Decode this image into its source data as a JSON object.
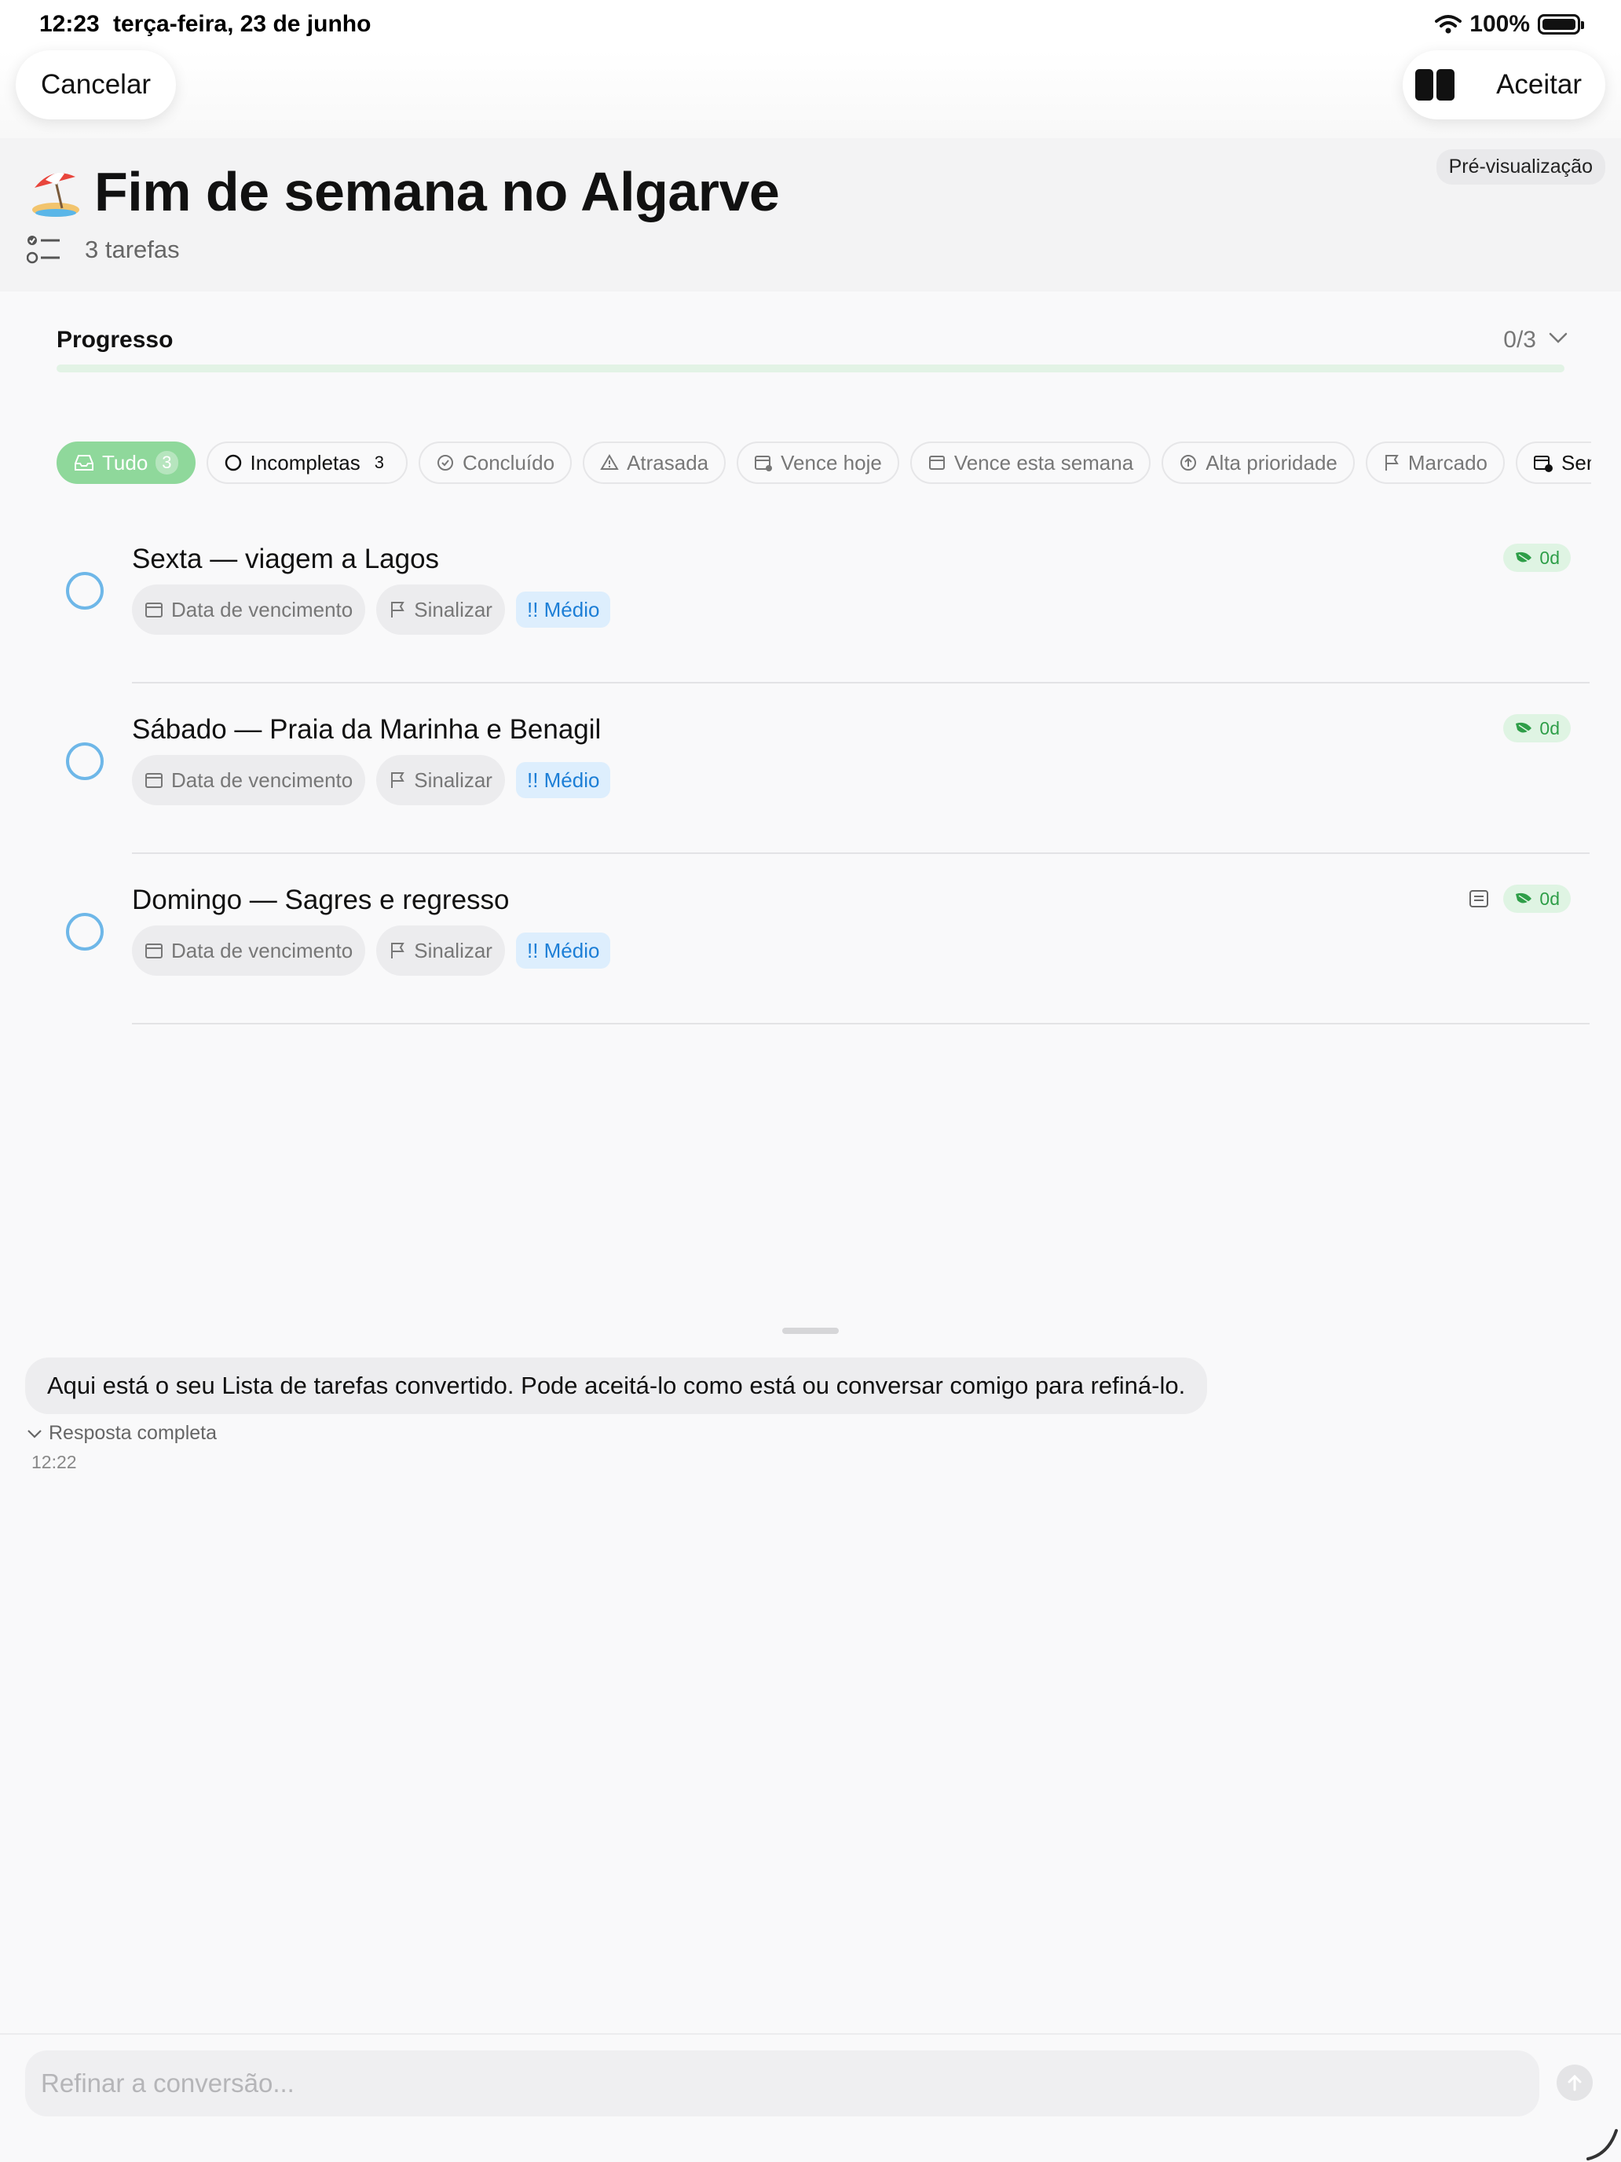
{
  "status_bar": {
    "time": "12:23",
    "date": "terça-feira, 23 de junho",
    "battery": "100%"
  },
  "nav": {
    "cancel_label": "Cancelar",
    "accept_label": "Aceitar"
  },
  "header": {
    "preview_badge": "Pré-visualização",
    "title": "Fim de semana no Algarve",
    "task_count": "3 tarefas"
  },
  "progress": {
    "label": "Progresso",
    "count": "0/3",
    "fraction": 0
  },
  "filters": [
    {
      "label": "Tudo",
      "count": "3",
      "icon": "inbox-icon",
      "active": true
    },
    {
      "label": "Incompletas",
      "count": "3",
      "icon": "circle-icon",
      "active": false
    },
    {
      "label": "Concluído",
      "count": "",
      "icon": "check-circle-icon",
      "active": false
    },
    {
      "label": "Atrasada",
      "count": "",
      "icon": "warning-icon",
      "active": false
    },
    {
      "label": "Vence hoje",
      "count": "",
      "icon": "calendar-today-icon",
      "active": false
    },
    {
      "label": "Vence esta semana",
      "count": "",
      "icon": "calendar-icon",
      "active": false
    },
    {
      "label": "Alta prioridade",
      "count": "",
      "icon": "arrow-up-circle-icon",
      "active": false
    },
    {
      "label": "Marcado",
      "count": "",
      "icon": "flag-icon",
      "active": false
    },
    {
      "label": "Sem data",
      "count": "",
      "icon": "calendar-none-icon",
      "active": false
    }
  ],
  "tasks": [
    {
      "title": "Sexta — viagem a Lagos",
      "due_label": "Data de vencimento",
      "flag_label": "Sinalizar",
      "priority": "!! Médio",
      "streak": "0d",
      "has_note": false
    },
    {
      "title": "Sábado — Praia da Marinha e Benagil",
      "due_label": "Data de vencimento",
      "flag_label": "Sinalizar",
      "priority": "!! Médio",
      "streak": "0d",
      "has_note": false
    },
    {
      "title": "Domingo — Sagres e regresso",
      "due_label": "Data de vencimento",
      "flag_label": "Sinalizar",
      "priority": "!! Médio",
      "streak": "0d",
      "has_note": true
    }
  ],
  "chat": {
    "message": "Aqui está o seu Lista de tarefas convertido. Pode aceitá-lo como está ou conversar comigo para refiná-lo.",
    "full_response_label": "Resposta completa",
    "time": "12:22"
  },
  "input": {
    "placeholder": "Refinar a conversão..."
  },
  "colors": {
    "accent_green": "#8fd89b",
    "priority_blue": "#1c7ed6",
    "radio_blue": "#6eb7e8"
  }
}
